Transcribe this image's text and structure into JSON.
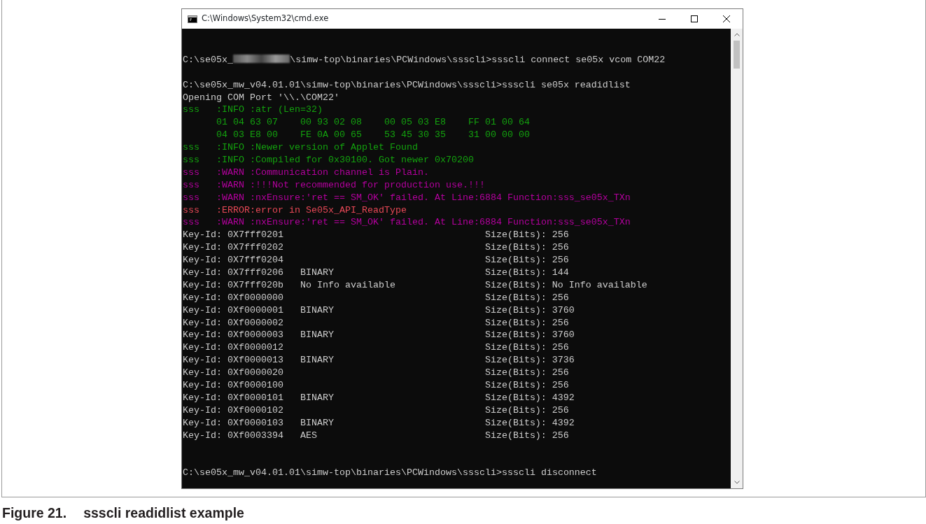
{
  "window": {
    "title": "C:\\Windows\\System32\\cmd.exe"
  },
  "console": [
    {
      "kind": "blank"
    },
    {
      "kind": "redacted_cmd",
      "prefix": "C:\\se05x_",
      "suffix": "\\simw-top\\binaries\\PCWindows\\ssscli>ssscli connect se05x vcom COM22"
    },
    {
      "kind": "blank"
    },
    {
      "kind": "cmd",
      "text": "C:\\se05x_mw_v04.01.01\\simw-top\\binaries\\PCWindows\\ssscli>ssscli se05x readidlist"
    },
    {
      "kind": "cmd",
      "text": "Opening COM Port '\\\\.\\COM22'"
    },
    {
      "kind": "log",
      "color": "#13a10e",
      "text": "sss   :INFO :atr (Len=32)"
    },
    {
      "kind": "hex",
      "text": "01 04 63 07    00 93 02 08    00 05 03 E8    FF 01 00 64"
    },
    {
      "kind": "hex",
      "text": "04 03 E8 00    FE 0A 00 65    53 45 30 35    31 00 00 00"
    },
    {
      "kind": "log",
      "color": "#13a10e",
      "text": "sss   :INFO :Newer version of Applet Found"
    },
    {
      "kind": "log",
      "color": "#13a10e",
      "text": "sss   :INFO :Compiled for 0x30100. Got newer 0x70200"
    },
    {
      "kind": "log",
      "color": "#b4009e",
      "text": "sss   :WARN :Communication channel is Plain."
    },
    {
      "kind": "log",
      "color": "#b4009e",
      "text": "sss   :WARN :!!!Not recommended for production use.!!!"
    },
    {
      "kind": "log",
      "color": "#b4009e",
      "text": "sss   :WARN :nxEnsure:'ret == SM_OK' failed. At Line:6884 Function:sss_se05x_TXn"
    },
    {
      "kind": "log",
      "color": "#e74856",
      "text": "sss   :ERROR:error in Se05x_API_ReadType"
    },
    {
      "kind": "log",
      "color": "#b4009e",
      "text": "sss   :WARN :nxEnsure:'ret == SM_OK' failed. At Line:6884 Function:sss_se05x_TXn"
    },
    {
      "kind": "key",
      "id": "Key-Id: 0X7fff0201",
      "size": "Size(Bits): 256"
    },
    {
      "kind": "key",
      "id": "Key-Id: 0X7fff0202",
      "size": "Size(Bits): 256"
    },
    {
      "kind": "key",
      "id": "Key-Id: 0X7fff0204",
      "size": "Size(Bits): 256"
    },
    {
      "kind": "key",
      "id": "Key-Id: 0X7fff0206",
      "type": "BINARY",
      "size": "Size(Bits): 144"
    },
    {
      "kind": "key",
      "id": "Key-Id: 0X7fff020b",
      "type": "No Info available",
      "size": "Size(Bits): No Info available"
    },
    {
      "kind": "key",
      "id": "Key-Id: 0Xf0000000",
      "size": "Size(Bits): 256"
    },
    {
      "kind": "key",
      "id": "Key-Id: 0Xf0000001",
      "type": "BINARY",
      "size": "Size(Bits): 3760"
    },
    {
      "kind": "key",
      "id": "Key-Id: 0Xf0000002",
      "size": "Size(Bits): 256"
    },
    {
      "kind": "key",
      "id": "Key-Id: 0Xf0000003",
      "type": "BINARY",
      "size": "Size(Bits): 3760"
    },
    {
      "kind": "key",
      "id": "Key-Id: 0Xf0000012",
      "size": "Size(Bits): 256"
    },
    {
      "kind": "key",
      "id": "Key-Id: 0Xf0000013",
      "type": "BINARY",
      "size": "Size(Bits): 3736"
    },
    {
      "kind": "key",
      "id": "Key-Id: 0Xf0000020",
      "size": "Size(Bits): 256"
    },
    {
      "kind": "key",
      "id": "Key-Id: 0Xf0000100",
      "size": "Size(Bits): 256"
    },
    {
      "kind": "key",
      "id": "Key-Id: 0Xf0000101",
      "type": "BINARY",
      "size": "Size(Bits): 4392"
    },
    {
      "kind": "key",
      "id": "Key-Id: 0Xf0000102",
      "size": "Size(Bits): 256"
    },
    {
      "kind": "key",
      "id": "Key-Id: 0Xf0000103",
      "type": "BINARY",
      "size": "Size(Bits): 4392"
    },
    {
      "kind": "key",
      "id": "Key-Id: 0Xf0003394",
      "type": "AES",
      "size": "Size(Bits): 256"
    },
    {
      "kind": "blank"
    },
    {
      "kind": "blank"
    },
    {
      "kind": "cmd",
      "text": "C:\\se05x_mw_v04.01.01\\simw-top\\binaries\\PCWindows\\ssscli>ssscli disconnect"
    }
  ],
  "caption": {
    "number": "Figure 21.",
    "text": "ssscli readidlist example"
  }
}
